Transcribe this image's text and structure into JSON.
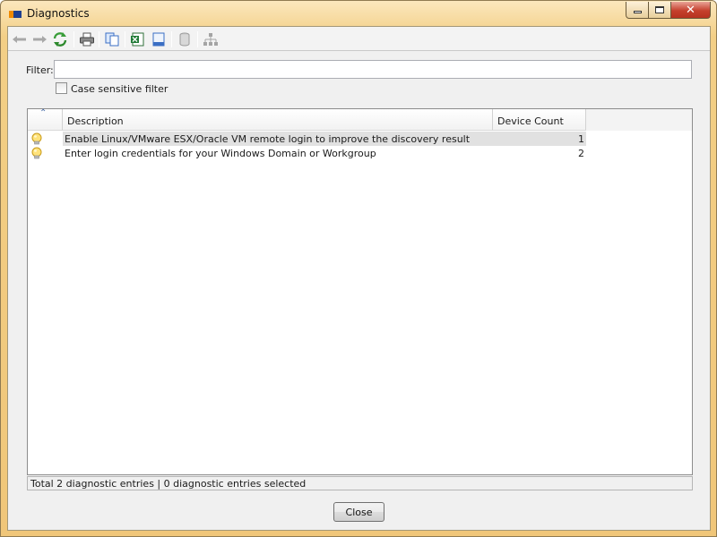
{
  "window": {
    "title": "Diagnostics",
    "accent": "#f0c679",
    "controls": [
      "minimize-icon",
      "maximize-icon",
      "close-icon"
    ]
  },
  "toolbar": {
    "buttons": [
      {
        "name": "back-arrow-icon",
        "enabled": false
      },
      {
        "name": "forward-arrow-icon",
        "enabled": false
      },
      {
        "name": "refresh-icon",
        "enabled": true
      },
      {
        "name": "print-icon",
        "enabled": true
      },
      {
        "name": "copy-icon",
        "enabled": true
      },
      {
        "name": "export-excel-icon",
        "enabled": true
      },
      {
        "name": "page-icon",
        "enabled": true
      },
      {
        "name": "database-icon",
        "enabled": false
      },
      {
        "name": "hierarchy-icon",
        "enabled": false
      }
    ]
  },
  "filter": {
    "label": "Filter:",
    "value": "",
    "case_sensitive_label": "Case sensitive filter",
    "case_sensitive_checked": false
  },
  "table": {
    "columns": [
      "",
      "Description",
      "Device Count"
    ],
    "rows": [
      {
        "icon": "lightbulb-icon",
        "description": "Enable Linux/VMware ESX/Oracle VM remote login to improve the discovery result",
        "count": "1",
        "selected": true
      },
      {
        "icon": "lightbulb-icon",
        "description": "Enter login credentials for your Windows Domain or Workgroup",
        "count": "2",
        "selected": false
      }
    ]
  },
  "status": {
    "text": "Total 2 diagnostic entries | 0 diagnostic entries selected"
  },
  "footer": {
    "close_label": "Close"
  }
}
